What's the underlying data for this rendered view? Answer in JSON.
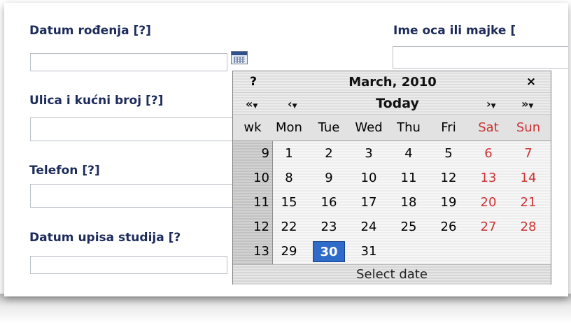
{
  "form": {
    "birth_date_label": "Datum rođenja [?]",
    "parent_name_label": "Ime oca ili majke [",
    "street_label": "Ulica i kućni broj [?]",
    "phone_label": "Telefon [?]",
    "enroll_date_label": "Datum upisa studija [?"
  },
  "calendar": {
    "help": "?",
    "title": "March, 2010",
    "close": "×",
    "prev_year": "«",
    "prev_month": "‹",
    "today": "Today",
    "next_month": "›",
    "next_year": "»",
    "wk_header": "wk",
    "weekdays": [
      "Mon",
      "Tue",
      "Wed",
      "Thu",
      "Fri",
      "Sat",
      "Sun"
    ],
    "weeks": [
      {
        "wk": "9",
        "days": [
          "1",
          "2",
          "3",
          "4",
          "5",
          "6",
          "7"
        ]
      },
      {
        "wk": "10",
        "days": [
          "8",
          "9",
          "10",
          "11",
          "12",
          "13",
          "14"
        ]
      },
      {
        "wk": "11",
        "days": [
          "15",
          "16",
          "17",
          "18",
          "19",
          "20",
          "21"
        ]
      },
      {
        "wk": "12",
        "days": [
          "22",
          "23",
          "24",
          "25",
          "26",
          "27",
          "28"
        ]
      },
      {
        "wk": "13",
        "days": [
          "29",
          "30",
          "31",
          "",
          "",
          "",
          ""
        ]
      }
    ],
    "selected_day": "30",
    "footer": "Select date"
  },
  "colors": {
    "label": "#1c2b5a",
    "weekend": "#cc3333",
    "selected": "#2f6bc9"
  }
}
